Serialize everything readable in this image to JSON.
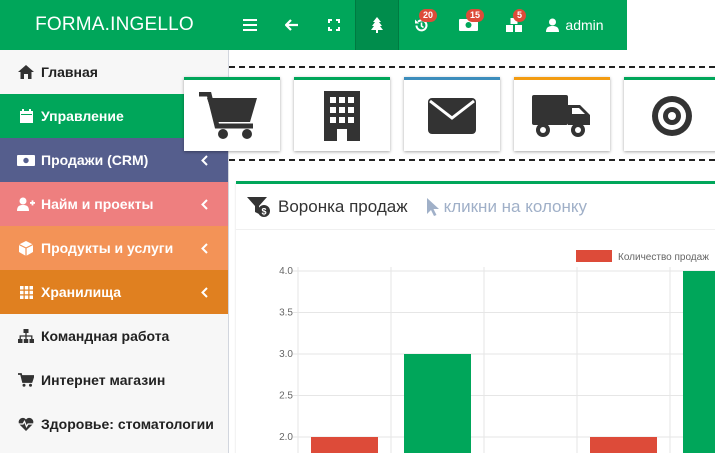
{
  "brand": {
    "title": "FORMA.INGELLO"
  },
  "navbar": {
    "menu_icon": "bars-icon",
    "back_icon": "arrow-left-icon",
    "fullscreen_icon": "expand-icon",
    "tree_icon": "tree-icon",
    "history_badge": "20",
    "money_badge": "15",
    "cubes_badge": "5",
    "user_label": "admin"
  },
  "sidebar": {
    "items": [
      {
        "label": "Главная",
        "icon": "home-icon"
      },
      {
        "label": "Управление",
        "icon": "calendar-icon"
      },
      {
        "label": "Продажи (CRM)",
        "icon": "money-icon"
      },
      {
        "label": "Найм и проекты",
        "icon": "user-plus-icon"
      },
      {
        "label": "Продукты и услуги",
        "icon": "cube-icon"
      },
      {
        "label": "Хранилища",
        "icon": "th-icon"
      },
      {
        "label": "Командная работа",
        "icon": "sitemap-icon"
      },
      {
        "label": "Интернет магазин",
        "icon": "cart-icon"
      },
      {
        "label": "Здоровье: стоматологии",
        "icon": "heartbeat-icon"
      }
    ]
  },
  "tiles": [
    "cart-icon",
    "building-icon",
    "envelope-icon",
    "truck-icon",
    "target-icon"
  ],
  "tile_colors": [
    "#00a65a",
    "#00a65a",
    "#3c8dbc",
    "#f39c12",
    "#00a65a"
  ],
  "funnel": {
    "title": "Воронка продаж",
    "hint": "кликни на колонку"
  },
  "chart_data": {
    "type": "bar",
    "legend": [
      "Количество продаж"
    ],
    "ylim": [
      1.8,
      4.0
    ],
    "yticks": [
      "4.0",
      "3.5",
      "3.0",
      "2.5",
      "2.0"
    ],
    "series": [
      {
        "name": "Количество продаж",
        "color": "#dd4b39",
        "values": [
          2.0,
          null,
          null,
          2.0,
          null
        ]
      },
      {
        "color": "#00a65a",
        "values": [
          null,
          3.0,
          null,
          null,
          4.0
        ]
      }
    ]
  }
}
